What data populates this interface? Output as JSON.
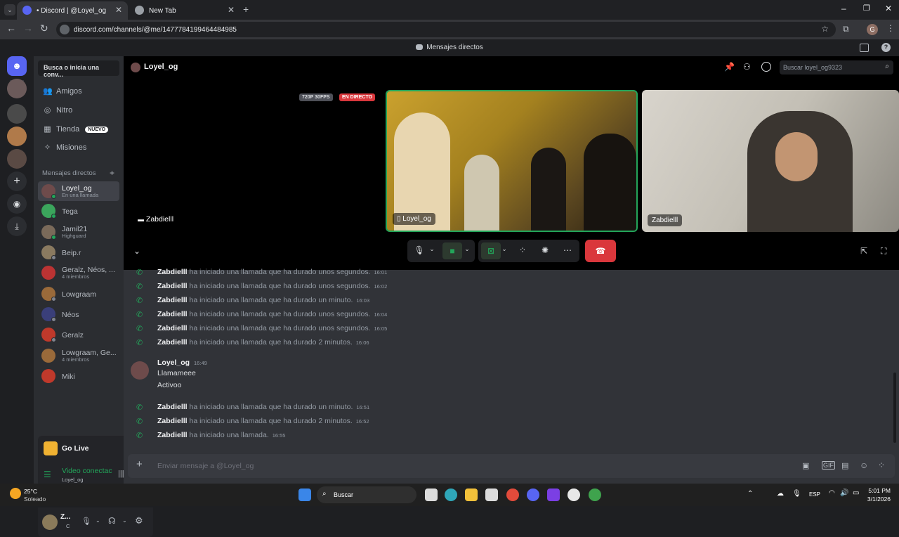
{
  "browser": {
    "tab_active_title": "• Discord | @Loyel_og",
    "tab_new_title": "New Tab",
    "url": "discord.com/channels/@me/1477784199464484985",
    "profile_initial": "G"
  },
  "discord": {
    "top_title": "Mensajes directos",
    "search_dm_label": "Busca o inicia una conv...",
    "nav": [
      {
        "label": "Amigos",
        "icon": "friends-icon"
      },
      {
        "label": "Nitro",
        "icon": "nitro-icon"
      },
      {
        "label": "Tienda",
        "icon": "shop-icon",
        "badge": "NUEVO"
      },
      {
        "label": "Misiones",
        "icon": "quests-icon"
      }
    ],
    "dm_section_title": "Mensajes directos",
    "dms": [
      {
        "name": "Loyel_og",
        "sub": "En una llamada",
        "color": "#6e4b4b",
        "status": "#23a55a",
        "selected": true
      },
      {
        "name": "Tega",
        "sub": "",
        "color": "#3ba55c",
        "status": "#23a55a"
      },
      {
        "name": "Jamil21",
        "sub": "Highguard",
        "color": "#7a6a5a",
        "status": "#23a55a"
      },
      {
        "name": "Beip.r",
        "sub": "",
        "color": "#8a7a60",
        "status": "#80848e"
      },
      {
        "name": "Geralz, Néos, ...",
        "sub": "4 miembros",
        "color": "#b33",
        "status": ""
      },
      {
        "name": "Lowgraam",
        "sub": "",
        "color": "#9a6a3a",
        "status": "#80848e"
      },
      {
        "name": "Néos",
        "sub": "",
        "color": "#3a3f7a",
        "status": "#80848e"
      },
      {
        "name": "Geralz",
        "sub": "",
        "color": "#c0392b",
        "status": "#80848e"
      },
      {
        "name": "Lowgraam, Ge...",
        "sub": "4 miembros",
        "color": "#9a6a3a",
        "status": ""
      },
      {
        "name": "Miki",
        "sub": "",
        "color": "#c0392b",
        "status": ""
      }
    ],
    "golive_label": "Go Live",
    "voice_status": "Video conectac",
    "voice_channel": "Loyel_og",
    "user_name": "Z...",
    "user_status": "C",
    "channel_name": "Loyel_og",
    "header_search_placeholder": "Buscar loyel_og9323",
    "stream_quality_badge": "720P 30FPS",
    "live_badge": "EN DIRECTO",
    "left_participant": "Zabdielll",
    "video_tiles": [
      {
        "name": "Loyel_og"
      },
      {
        "name": "Zabdielll"
      }
    ],
    "messages": [
      {
        "kind": "call",
        "user": "Zabdielll",
        "text": "ha iniciado una llamada que ha durado unos segundos.",
        "time": "16:01"
      },
      {
        "kind": "call",
        "user": "Zabdielll",
        "text": "ha iniciado una llamada que ha durado unos segundos.",
        "time": "16:02"
      },
      {
        "kind": "call",
        "user": "Zabdielll",
        "text": "ha iniciado una llamada que ha durado un minuto.",
        "time": "16:03"
      },
      {
        "kind": "call",
        "user": "Zabdielll",
        "text": "ha iniciado una llamada que ha durado unos segundos.",
        "time": "16:04"
      },
      {
        "kind": "call",
        "user": "Zabdielll",
        "text": "ha iniciado una llamada que ha durado unos segundos.",
        "time": "16:05"
      },
      {
        "kind": "call",
        "user": "Zabdielll",
        "text": "ha iniciado una llamada que ha durado 2 minutos.",
        "time": "16:06"
      }
    ],
    "user_message": {
      "author": "Loyel_og",
      "time": "16:49",
      "lines": [
        "Llamameee",
        "Activoo"
      ]
    },
    "messages_after": [
      {
        "user": "Zabdielll",
        "text": "ha iniciado una llamada que ha durado un minuto.",
        "time": "16:51"
      },
      {
        "user": "Zabdielll",
        "text": "ha iniciado una llamada que ha durado 2 minutos.",
        "time": "16:52"
      },
      {
        "user": "Zabdielll",
        "text": "ha iniciado una llamada.",
        "time": "16:55"
      }
    ],
    "composer_placeholder": "Enviar mensaje a @Loyel_og"
  },
  "taskbar": {
    "weather_temp": "25°C",
    "weather_desc": "Soleado",
    "search_label": "Buscar",
    "lang": "ESP",
    "time": "5:01 PM",
    "date": "3/1/2026"
  }
}
